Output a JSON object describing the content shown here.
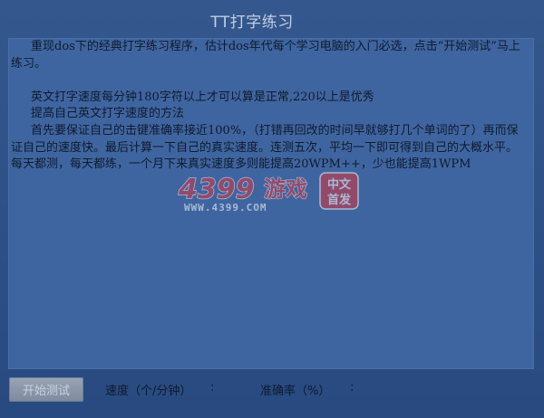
{
  "app": {
    "title": "TT打字练习"
  },
  "text_panel": {
    "paragraphs": [
      "重现dos下的经典打字练习程序，估计dos年代每个学习电脑的入门必选，点击“开始测试”马上练习。",
      "",
      "英文打字速度每分钟180字符以上才可以算是正常,220以上是优秀",
      "提高自己英文打字速度的方法",
      "首先要保证自己的击键准确率接近100%，（打错再回改的时间早就够打几个单词的了）再而保证自己的速度快。最后计算一下自己的真实速度。连测五次，平均一下即可得到自己的大概水平。每天都测，每天都练，一个月下来真实速度多则能提高20WPM++，少也能提高1WPM"
    ]
  },
  "watermark": {
    "brand": "4399",
    "game_text": "游戏",
    "url": "WWW.4399.COM",
    "badge_line1": "中文",
    "badge_line2": "首发",
    "colors": {
      "red": "#d8343f",
      "white": "#ffffff"
    }
  },
  "bottom_bar": {
    "start_button_label": "开始测试",
    "speed_label": "速度（个/分钟）",
    "speed_value": ":",
    "accuracy_label": "准确率（%）",
    "accuracy_value": ":"
  },
  "colors": {
    "background": "#2f5389",
    "panel": "#3f65a0",
    "text": "#0f1a2c",
    "title": "#c4cfe2",
    "button": "#8e9aac"
  }
}
